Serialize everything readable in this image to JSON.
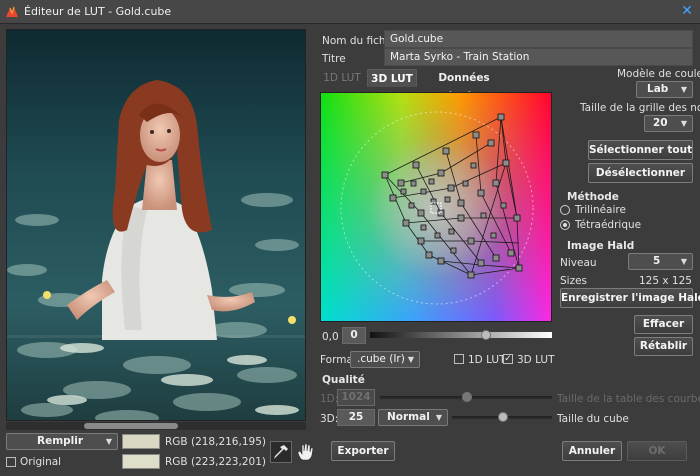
{
  "window": {
    "title": "Éditeur de LUT - Gold.cube",
    "close_icon": "close-icon"
  },
  "file": {
    "name_label": "Nom du fichier",
    "name_value": "Gold.cube",
    "title_label": "Titre",
    "title_value": "Marta Syrko - Train Station"
  },
  "tabs": [
    {
      "label": "1D LUT",
      "state": "disabled"
    },
    {
      "label": "3D LUT",
      "state": "active"
    },
    {
      "label": "Données texte",
      "state": "normal"
    }
  ],
  "color_model": {
    "label": "Modèle de couleur",
    "value": "Lab"
  },
  "grid_size": {
    "label": "Taille de la grille des nœuds",
    "value": "20"
  },
  "buttons": {
    "select_all": "Sélectionner tout",
    "deselect": "Désélectionner",
    "save_hald": "Enregistrer l'image Hald",
    "clear": "Effacer",
    "restore": "Rétablir",
    "export": "Exporter",
    "cancel": "Annuler",
    "ok": "OK"
  },
  "method": {
    "title": "Méthode",
    "options": [
      {
        "label": "Trilinéaire",
        "selected": false
      },
      {
        "label": "Tétraédrique",
        "selected": true
      }
    ]
  },
  "hald": {
    "title": "Image Hald",
    "level_label": "Niveau",
    "level_value": "5",
    "sizes_label": "Sizes",
    "sizes_value": "125 x 125"
  },
  "lightness": {
    "min_label": "0,0",
    "value": "0",
    "position": 0.64
  },
  "format": {
    "label": "Format",
    "value": ".cube (Ir)",
    "check_1d": {
      "label": "1D LUT",
      "checked": false
    },
    "check_3d": {
      "label": "3D LUT",
      "checked": true
    }
  },
  "quality": {
    "title": "Qualité",
    "row_1d": {
      "label": "1D:",
      "value": "1024",
      "desc": "Taille de la table des courbes",
      "position": 0.5
    },
    "row_3d": {
      "label": "3D:",
      "value": "25",
      "mode": "Normal",
      "desc": "Taille du cube",
      "position": 0.5
    }
  },
  "bottom": {
    "fill_value": "Remplir",
    "original_label": "Original",
    "original_checked": false,
    "rgb_top": "RGB (218,216,195)",
    "rgb_bottom": "RGB (223,223,201)",
    "color_top": "#dad8c3",
    "color_bottom": "#dfdfc9"
  },
  "tools": {
    "eyedropper": "eyedropper-icon",
    "hand": "hand-icon"
  }
}
